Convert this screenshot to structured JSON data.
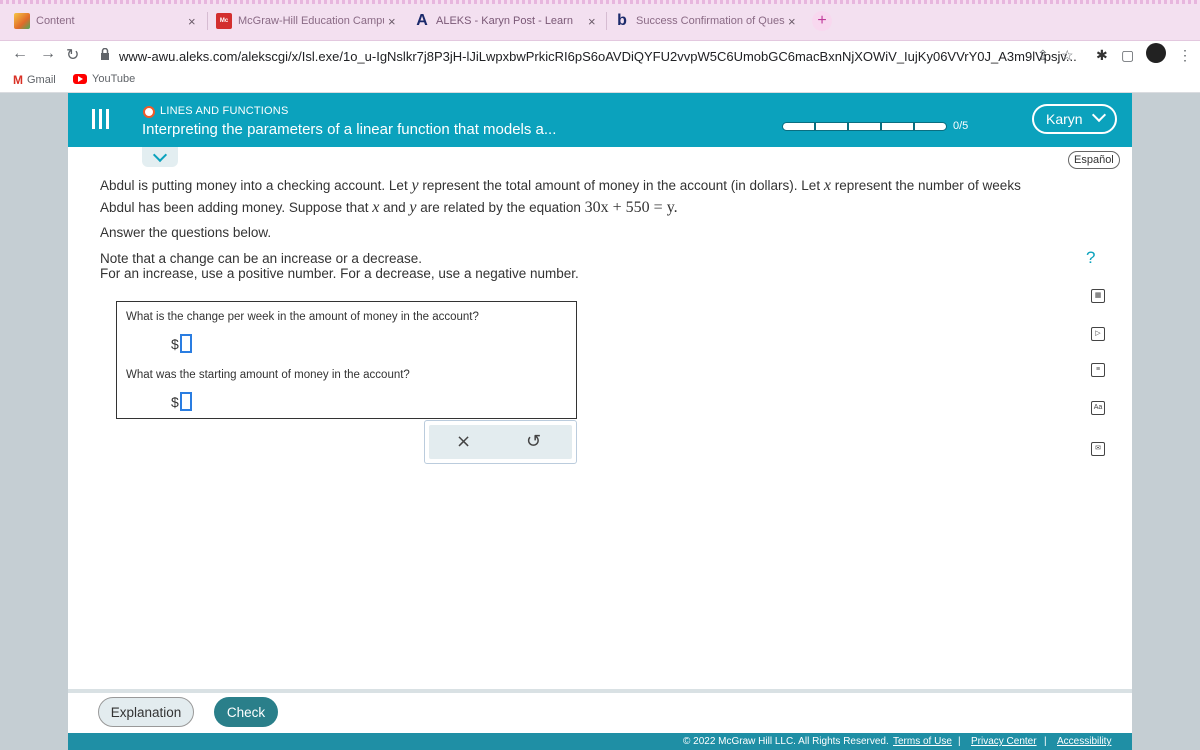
{
  "browser": {
    "tabs": [
      {
        "title": "Content",
        "favicon": "content-icon"
      },
      {
        "title": "McGraw-Hill Education Campu",
        "favicon": "mcgraw-hill-icon"
      },
      {
        "title": "ALEKS - Karyn Post - Learn",
        "favicon": "aleks-icon"
      },
      {
        "title": "Success Confirmation of Ques",
        "favicon": "bartleby-icon"
      }
    ],
    "url": "www-awu.aleks.com/alekscgi/x/Isl.exe/1o_u-IgNslkr7j8P3jH-lJiLwpxbwPrkicRI6pS6oAVDiQYFU2vvpW5C6UmobGC6macBxnNjXOWiV_IujKy06VVrY0J_A3m9lVpsjv...",
    "bookmarks": [
      {
        "label": "Gmail",
        "icon": "gmail-icon"
      },
      {
        "label": "YouTube",
        "icon": "youtube-icon"
      }
    ]
  },
  "header": {
    "topic": "LINES AND FUNCTIONS",
    "title": "Interpreting the parameters of a linear function that models a...",
    "progress": {
      "label": "0/5",
      "completed": 0,
      "total": 5
    },
    "user": "Karyn"
  },
  "language_button": "Español",
  "problem": {
    "part1": "Abdul is putting money into a checking account. Let",
    "var_y": "y",
    "part2": "represent the total amount of money in the account (in dollars). Let",
    "var_x": "x",
    "part3": "represent the number of weeks Abdul has been adding money. Suppose that",
    "var_x2": "x",
    "and": "and",
    "var_y2": "y",
    "part4": "are related by the equation",
    "equation": "30x + 550 = y.",
    "answer_below": "Answer the questions below.",
    "note_line1": "Note that a change can be an increase or a decrease.",
    "note_line2": "For an increase, use a positive number. For a decrease, use a negative number."
  },
  "questions": [
    {
      "prompt": "What is the change per week in the amount of money in the account?",
      "prefix": "$",
      "value": ""
    },
    {
      "prompt": "What was the starting amount of money in the account?",
      "prefix": "$",
      "value": ""
    }
  ],
  "actions": {
    "clear": "×",
    "undo": "↺"
  },
  "footer": {
    "explanation": "Explanation",
    "check": "Check",
    "copyright": "© 2022 McGraw Hill LLC. All Rights Reserved.",
    "terms": "Terms of Use",
    "privacy": "Privacy Center",
    "accessibility": "Accessibility",
    "sep": "|"
  },
  "side_tools": {
    "help": "?",
    "dictionary": "Aa"
  },
  "colors": {
    "header": "#0ba2bd",
    "check_button": "#2a7f8a",
    "input_border": "#2a7de1",
    "topic_dot": "#ef5a2a"
  }
}
